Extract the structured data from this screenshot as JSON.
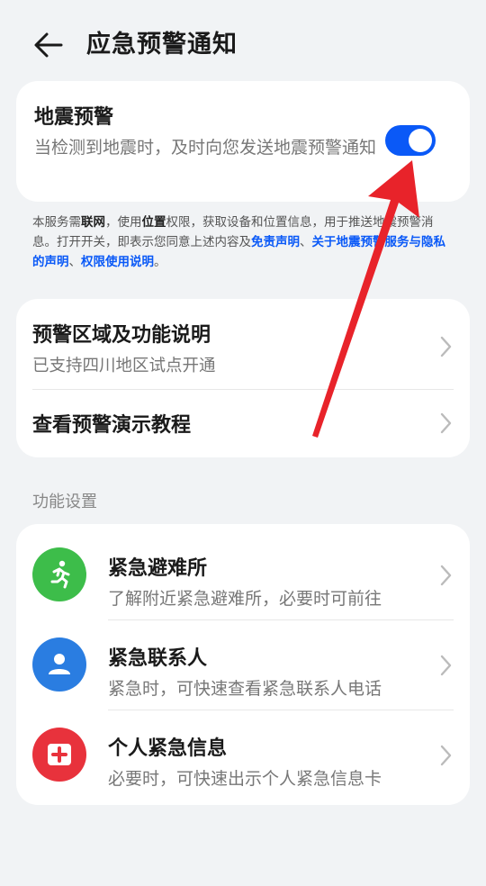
{
  "header": {
    "title": "应急预警通知",
    "back_icon": "back-arrow-icon"
  },
  "earthquake_alert": {
    "title": "地震预警",
    "description": "当检测到地震时，及时向您发送地震预警通知",
    "toggle_on": true,
    "accent_color": "#0a59f7"
  },
  "notice": {
    "part1": "本服务需",
    "bold1": "联网",
    "part2": "，使用",
    "bold2": "位置",
    "part3": "权限，获取设备和位置信息，用于推送地震预警消息。打开开关，即表示您同意上述内容及",
    "link1": "免责声明",
    "sep1": "、",
    "link2": "关于地震预警服务与隐私的声明",
    "sep2": "、",
    "link3": "权限使用说明",
    "end": "。"
  },
  "info_card": {
    "items": [
      {
        "title": "预警区域及功能说明",
        "subtitle": "已支持四川地区试点开通"
      },
      {
        "title": "查看预警演示教程"
      }
    ]
  },
  "features": {
    "section_title": "功能设置",
    "items": [
      {
        "title": "紧急避难所",
        "subtitle": "了解附近紧急避难所，必要时可前往",
        "icon": "running-person-icon",
        "color": "#3dbd4a"
      },
      {
        "title": "紧急联系人",
        "subtitle": "紧急时，可快速查看紧急联系人电话",
        "icon": "contact-person-icon",
        "color": "#2a7de1"
      },
      {
        "title": "个人紧急信息",
        "subtitle": "必要时，可快速出示个人紧急信息卡",
        "icon": "medical-cross-icon",
        "color": "#e8323c"
      }
    ]
  },
  "annotation": {
    "color": "#e8232a"
  }
}
